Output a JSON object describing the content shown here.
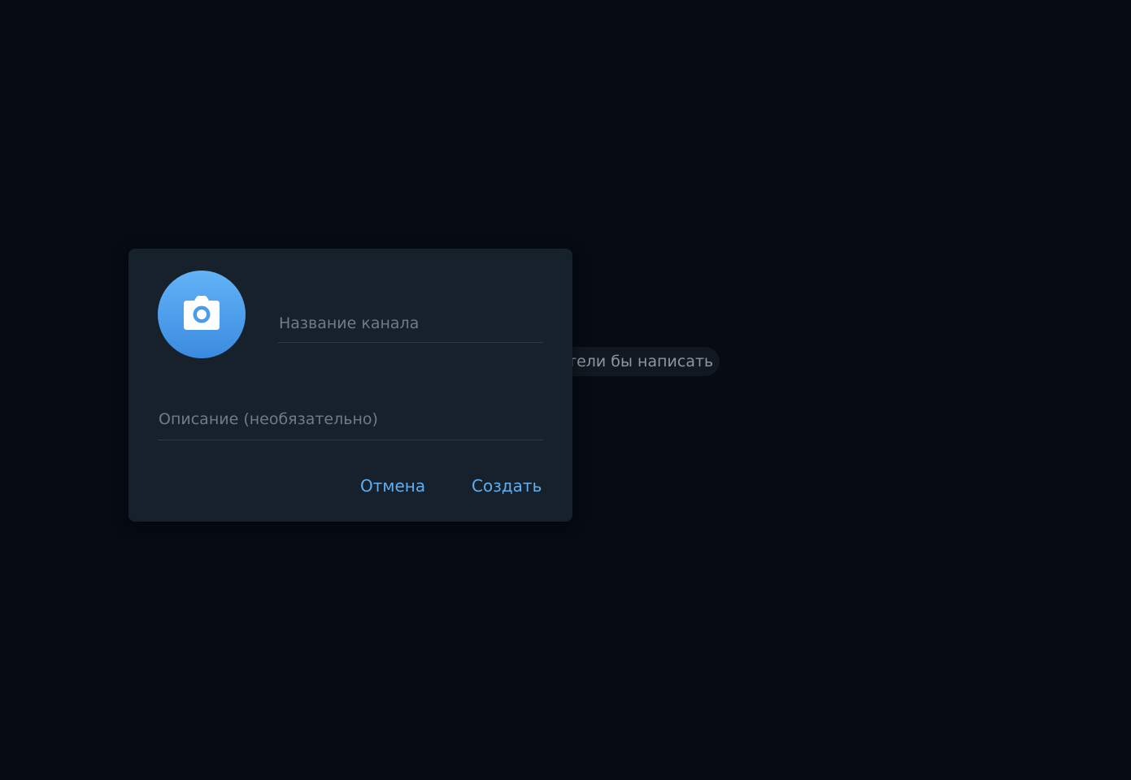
{
  "background": {
    "hint_text": "тели бы написать"
  },
  "dialog": {
    "title_field": {
      "placeholder": "Название канала",
      "value": ""
    },
    "description_field": {
      "placeholder": "Описание (необязательно)",
      "value": ""
    },
    "avatar_icon": "camera-icon",
    "cancel_label": "Отмена",
    "create_label": "Создать"
  },
  "colors": {
    "background": "#070b12",
    "dialog": "#17212b",
    "accent": "#5eaef2",
    "avatar_gradient_top": "#63b3f7",
    "avatar_gradient_bottom": "#3a8be0"
  }
}
